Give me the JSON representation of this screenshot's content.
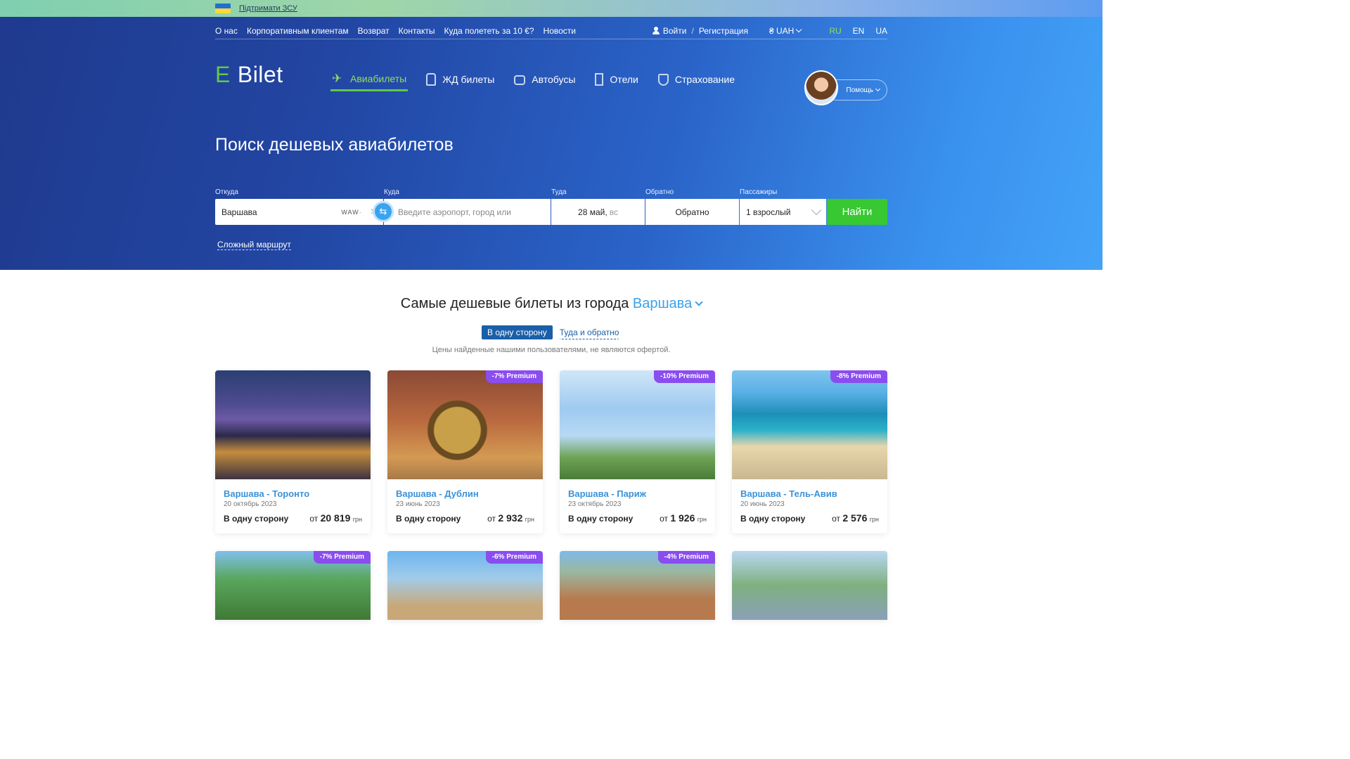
{
  "support": {
    "text": "Підтримати ЗСУ"
  },
  "topnav": {
    "links": [
      "О нас",
      "Корпоративным клиентам",
      "Возврат",
      "Контакты",
      "Куда полететь за 10 €?",
      "Новости"
    ],
    "login": "Войти",
    "register": "Регистрация",
    "currency": "₴ UAH",
    "languages": [
      "RU",
      "EN",
      "UA"
    ],
    "active_language": "RU"
  },
  "logo": {
    "e": "E",
    "rest": "Bilet"
  },
  "mainnav": [
    {
      "label": "Авиабилеты",
      "icon": "plane-icon",
      "active": true
    },
    {
      "label": "ЖД билеты",
      "icon": "train-icon",
      "active": false
    },
    {
      "label": "Автобусы",
      "icon": "bus-icon",
      "active": false
    },
    {
      "label": "Отели",
      "icon": "hotel-icon",
      "active": false
    },
    {
      "label": "Страхование",
      "icon": "shield-icon",
      "active": false
    }
  ],
  "help": {
    "label": "Помощь"
  },
  "hero": {
    "title": "Поиск дешевых авиабилетов"
  },
  "search": {
    "from_label": "Откуда",
    "from_value": "Варшава",
    "from_code": "WAW·",
    "to_label": "Куда",
    "to_placeholder": "Введите аэропорт, город или",
    "depart_label": "Туда",
    "depart_value": "28 май,",
    "depart_dow": "вс",
    "return_label": "Обратно",
    "return_value": "Обратно",
    "passengers_label": "Пассажиры",
    "passengers_value": "1 взрослый",
    "find_button": "Найти",
    "complex_route": "Сложный маршрут"
  },
  "cheapest": {
    "title_prefix": "Самые дешевые билеты из города",
    "city": "Варшава",
    "tab_oneway": "В одну сторону",
    "tab_roundtrip": "Туда и обратно",
    "disclaimer": "Цены найденные нашими пользователями, не являются офертой."
  },
  "cards": [
    {
      "route": "Варшава - Торонто",
      "date": "20 октябрь 2023",
      "direction": "В одну сторону",
      "price_prefix": "от",
      "price": "20 819",
      "currency": "грн",
      "badge": ""
    },
    {
      "route": "Варшава - Дублин",
      "date": "23 июнь 2023",
      "direction": "В одну сторону",
      "price_prefix": "от",
      "price": "2 932",
      "currency": "грн",
      "badge": "-7% Premium"
    },
    {
      "route": "Варшава - Париж",
      "date": "23 октябрь 2023",
      "direction": "В одну сторону",
      "price_prefix": "от",
      "price": "1 926",
      "currency": "грн",
      "badge": "-10% Premium"
    },
    {
      "route": "Варшава - Тель-Авив",
      "date": "20 июнь 2023",
      "direction": "В одну сторону",
      "price_prefix": "от",
      "price": "2 576",
      "currency": "грн",
      "badge": "-8% Premium"
    }
  ],
  "cards_row2": [
    {
      "badge": "-7% Premium"
    },
    {
      "badge": "-6% Premium"
    },
    {
      "badge": "-4% Premium"
    },
    {
      "badge": ""
    }
  ]
}
